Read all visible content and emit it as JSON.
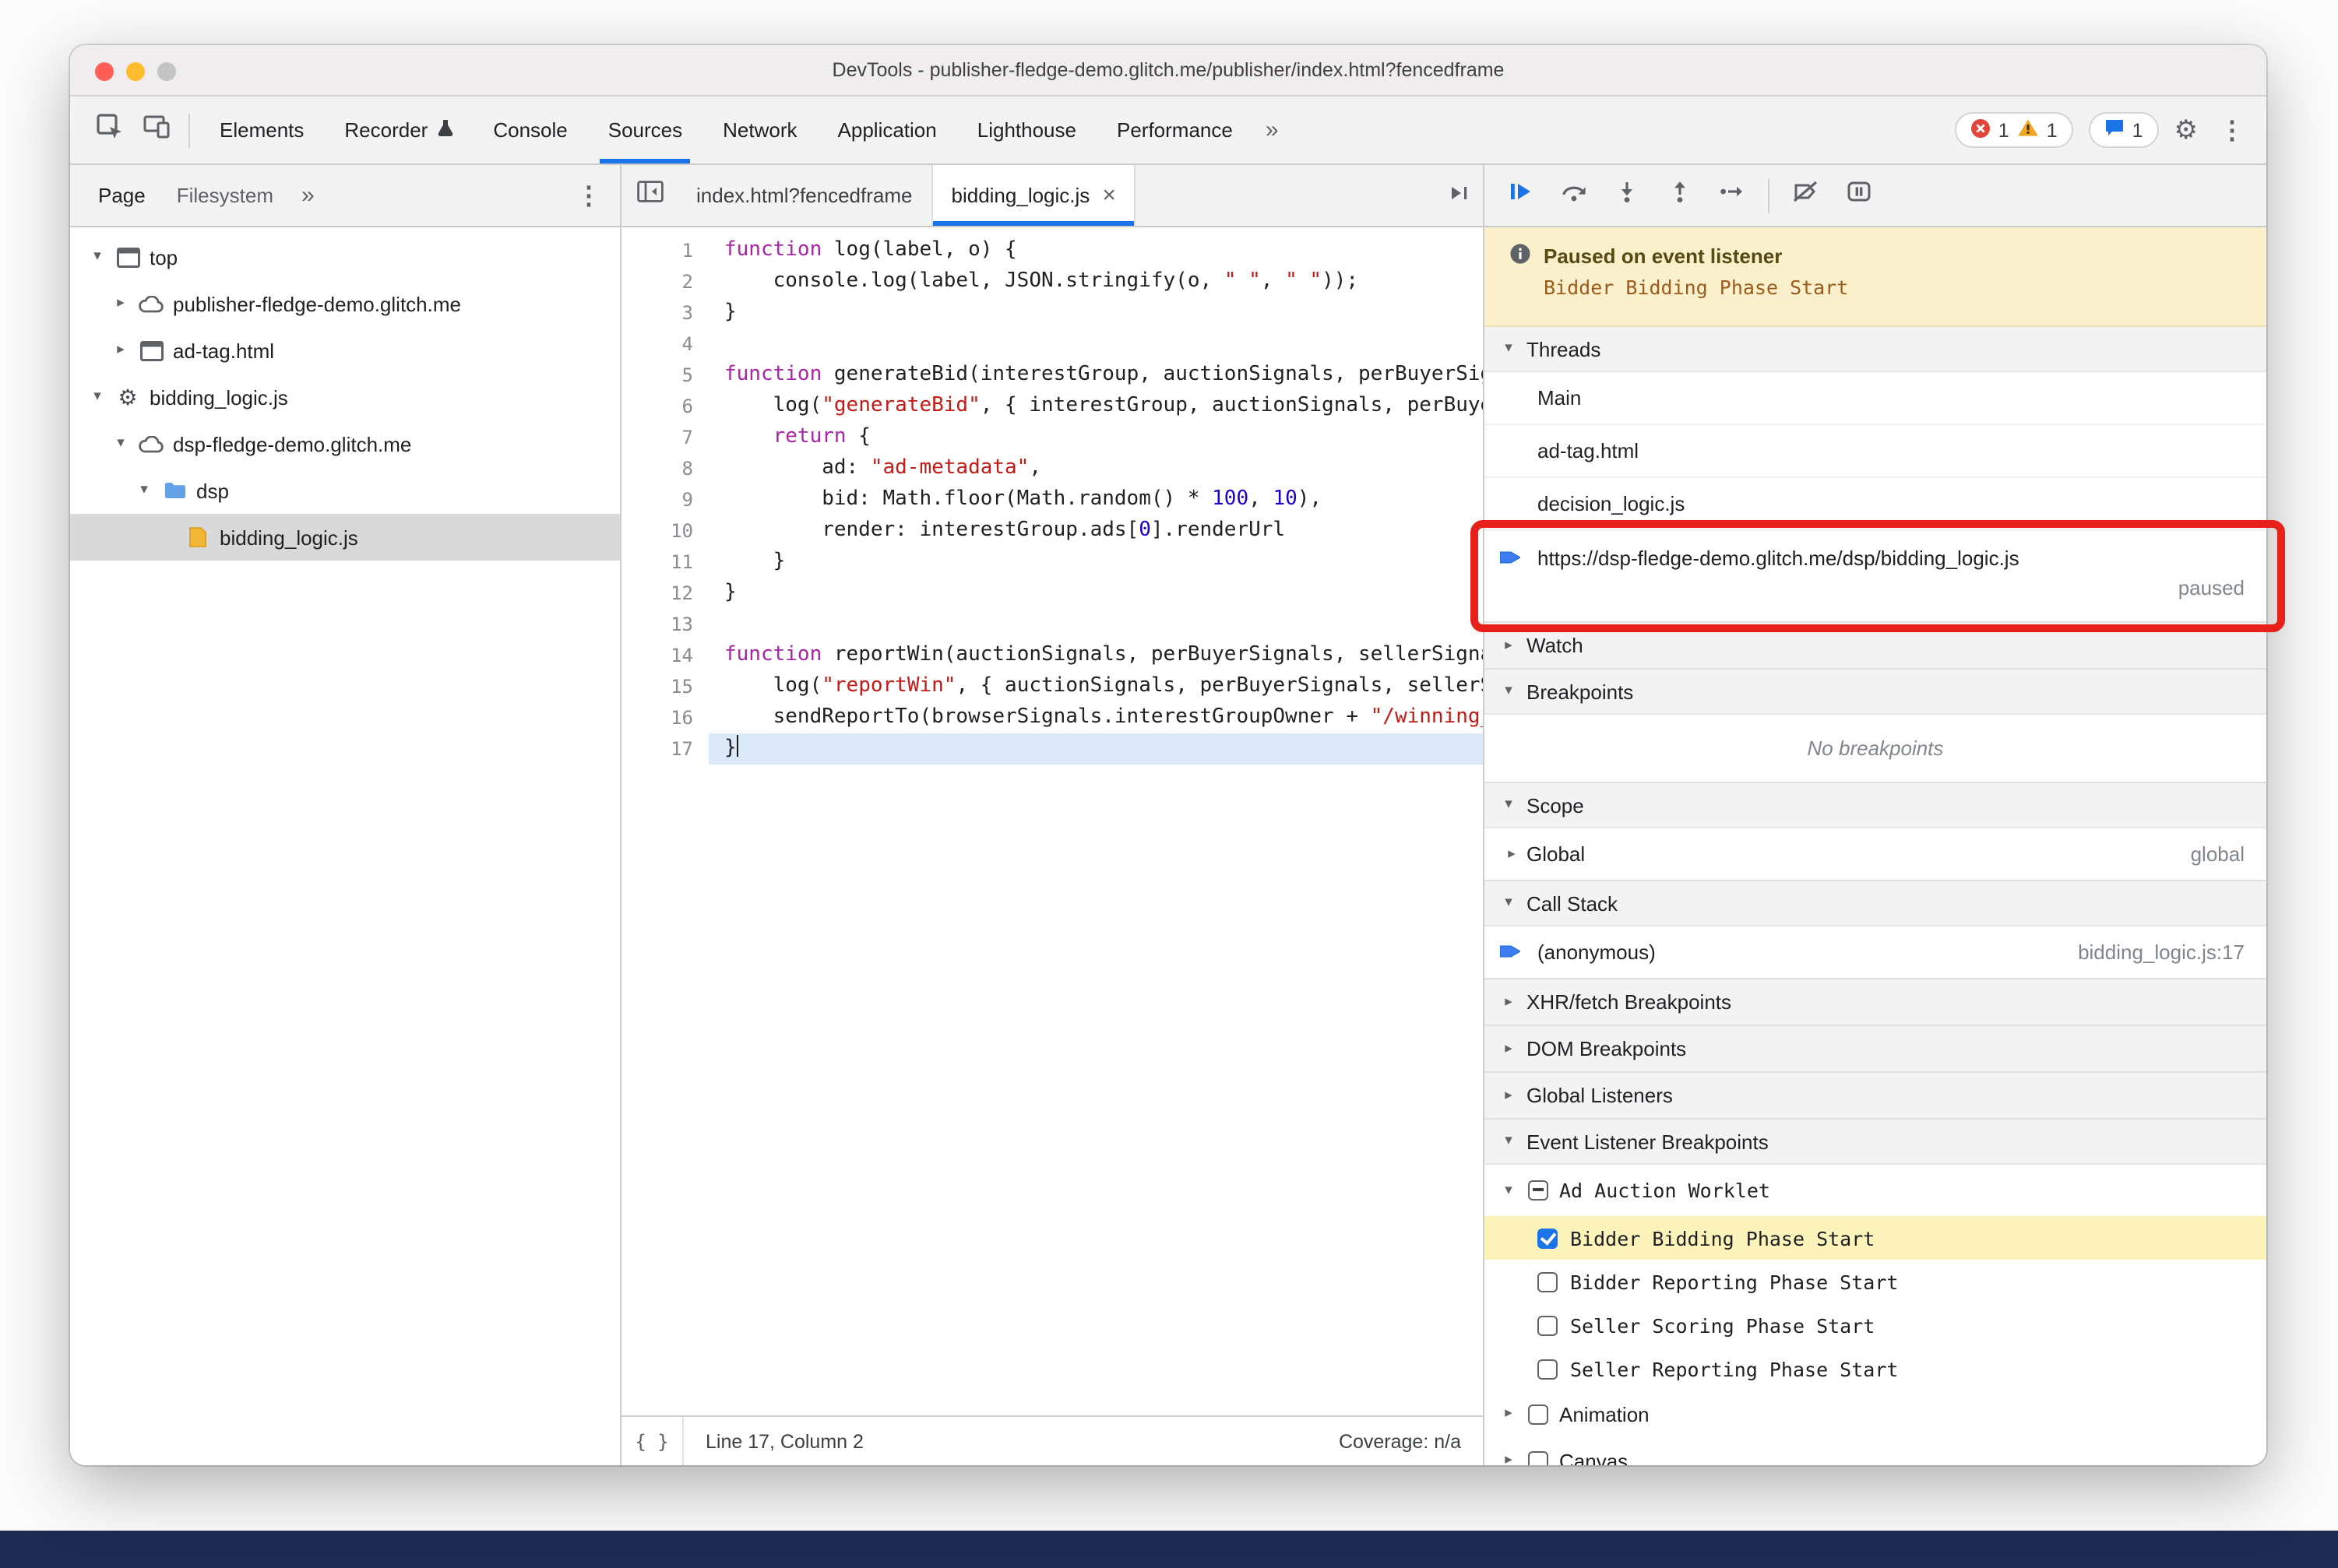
{
  "colors": {
    "accent_blue": "#1a73e8",
    "annotation_red": "#e8201a",
    "paused_banner_bg": "#fbf0cc",
    "selection_gray": "#d9d9d9",
    "breakpoint_highlight_yellow": "#fcf3bb",
    "paused_line_blue": "#dce9f9",
    "error_red": "#e5443b",
    "warning_yellow": "#f0a61f",
    "bottom_strip_navy": "#1e2a52"
  },
  "icons": {
    "gear": "⚙",
    "kebab": "⋮",
    "chevron_double": "»",
    "disclosure_open": "▾",
    "disclosure_closed": "▸",
    "close": "×",
    "pretty_print": "{ }"
  },
  "window": {
    "title": "DevTools - publisher-fledge-demo.glitch.me/publisher/index.html?fencedframe"
  },
  "toolbar": {
    "tabs": [
      {
        "label": "Elements"
      },
      {
        "label": "Recorder",
        "badge": "beaker-icon"
      },
      {
        "label": "Console"
      },
      {
        "label": "Sources",
        "active": true
      },
      {
        "label": "Network"
      },
      {
        "label": "Application"
      },
      {
        "label": "Lighthouse"
      },
      {
        "label": "Performance"
      }
    ],
    "error_count": "1",
    "warning_count": "1",
    "issue_count": "1"
  },
  "sidebar": {
    "tabs": [
      {
        "label": "Page",
        "active": true
      },
      {
        "label": "Filesystem"
      }
    ],
    "tree": [
      {
        "label": "top",
        "icon": "frame-icon",
        "disclosure": "open",
        "level": 0
      },
      {
        "label": "publisher-fledge-demo.glitch.me",
        "icon": "cloud-icon",
        "disclosure": "closed",
        "level": 1
      },
      {
        "label": "ad-tag.html",
        "icon": "frame-icon",
        "disclosure": "closed",
        "level": 1
      },
      {
        "label": "bidding_logic.js",
        "icon": "gear-icon",
        "disclosure": "open",
        "level": 0
      },
      {
        "label": "dsp-fledge-demo.glitch.me",
        "icon": "cloud-icon",
        "disclosure": "open",
        "level": 1
      },
      {
        "label": "dsp",
        "icon": "folder-icon",
        "disclosure": "open",
        "level": 2
      },
      {
        "label": "bidding_logic.js",
        "icon": "js-file-icon",
        "disclosure": "none",
        "level": 3,
        "selected": true
      }
    ]
  },
  "editor": {
    "tabs": [
      {
        "label": "index.html?fencedframe"
      },
      {
        "label": "bidding_logic.js",
        "active": true,
        "closable": true
      }
    ],
    "paused_line": 17,
    "code_lines": [
      {
        "n": 1,
        "tokens": [
          {
            "c": "k",
            "t": "function"
          },
          {
            "c": "d",
            "t": " log(label, o) {"
          }
        ]
      },
      {
        "n": 2,
        "tokens": [
          {
            "c": "d",
            "t": "    console.log(label, JSON.stringify(o, "
          },
          {
            "c": "s",
            "t": "\" \""
          },
          {
            "c": "d",
            "t": ", "
          },
          {
            "c": "s",
            "t": "\" \""
          },
          {
            "c": "d",
            "t": "));"
          }
        ]
      },
      {
        "n": 3,
        "tokens": [
          {
            "c": "d",
            "t": "}"
          }
        ]
      },
      {
        "n": 4,
        "tokens": []
      },
      {
        "n": 5,
        "tokens": [
          {
            "c": "k",
            "t": "function"
          },
          {
            "c": "d",
            "t": " generateBid(interestGroup, auctionSignals, perBuyerSignals, trustedBiddingSignals, browserSignals) {"
          }
        ]
      },
      {
        "n": 6,
        "tokens": [
          {
            "c": "d",
            "t": "    log("
          },
          {
            "c": "s",
            "t": "\"generateBid\""
          },
          {
            "c": "d",
            "t": ", { interestGroup, auctionSignals, perBuyerSignals, trustedBiddingSignals });"
          }
        ]
      },
      {
        "n": 7,
        "tokens": [
          {
            "c": "d",
            "t": "    "
          },
          {
            "c": "k",
            "t": "return"
          },
          {
            "c": "d",
            "t": " {"
          }
        ]
      },
      {
        "n": 8,
        "tokens": [
          {
            "c": "d",
            "t": "        ad: "
          },
          {
            "c": "s",
            "t": "\"ad-metadata\""
          },
          {
            "c": "d",
            "t": ","
          }
        ]
      },
      {
        "n": 9,
        "tokens": [
          {
            "c": "d",
            "t": "        bid: Math.floor(Math.random() * "
          },
          {
            "c": "n",
            "t": "100"
          },
          {
            "c": "d",
            "t": ", "
          },
          {
            "c": "n",
            "t": "10"
          },
          {
            "c": "d",
            "t": "),"
          }
        ]
      },
      {
        "n": 10,
        "tokens": [
          {
            "c": "d",
            "t": "        render: interestGroup.ads["
          },
          {
            "c": "n",
            "t": "0"
          },
          {
            "c": "d",
            "t": "].renderUrl"
          }
        ]
      },
      {
        "n": 11,
        "tokens": [
          {
            "c": "d",
            "t": "    }"
          }
        ]
      },
      {
        "n": 12,
        "tokens": [
          {
            "c": "d",
            "t": "}"
          }
        ]
      },
      {
        "n": 13,
        "tokens": []
      },
      {
        "n": 14,
        "tokens": [
          {
            "c": "k",
            "t": "function"
          },
          {
            "c": "d",
            "t": " reportWin(auctionSignals, perBuyerSignals, sellerSignals, browserSignals) {"
          }
        ]
      },
      {
        "n": 15,
        "tokens": [
          {
            "c": "d",
            "t": "    log("
          },
          {
            "c": "s",
            "t": "\"reportWin\""
          },
          {
            "c": "d",
            "t": ", { auctionSignals, perBuyerSignals, sellerSignals, browserSignals });"
          }
        ]
      },
      {
        "n": 16,
        "tokens": [
          {
            "c": "d",
            "t": "    sendReportTo(browserSignals.interestGroupOwner + "
          },
          {
            "c": "s",
            "t": "\"/winning_bid\""
          },
          {
            "c": "d",
            "t": ");"
          }
        ]
      },
      {
        "n": 17,
        "tokens": [
          {
            "c": "d",
            "t": "}"
          }
        ],
        "caret": true
      }
    ],
    "status": {
      "line_col": "Line 17, Column 2",
      "coverage": "Coverage: n/a"
    }
  },
  "debugger": {
    "banner": {
      "title": "Paused on event listener",
      "detail": "Bidder Bidding Phase Start"
    },
    "threads": {
      "title": "Threads",
      "rows": [
        {
          "label": "Main"
        },
        {
          "label": "ad-tag.html"
        },
        {
          "label": "decision_logic.js"
        },
        {
          "label": "https://dsp-fledge-demo.glitch.me/dsp/bidding_logic.js",
          "status": "paused",
          "active": true
        }
      ]
    },
    "watch": {
      "title": "Watch"
    },
    "breakpoints": {
      "title": "Breakpoints",
      "empty_text": "No breakpoints"
    },
    "scope": {
      "title": "Scope",
      "rows": [
        {
          "label": "Global",
          "annotation": "global"
        }
      ]
    },
    "call_stack": {
      "title": "Call Stack",
      "rows": [
        {
          "label": "(anonymous)",
          "location": "bidding_logic.js:17",
          "active": true
        }
      ]
    },
    "xhr_breakpoints": {
      "title": "XHR/fetch Breakpoints"
    },
    "dom_breakpoints": {
      "title": "DOM Breakpoints"
    },
    "global_listeners": {
      "title": "Global Listeners"
    },
    "event_listener_breakpoints": {
      "title": "Event Listener Breakpoints",
      "groups": [
        {
          "label": "Ad Auction Worklet",
          "checkbox": "indeterminate",
          "expanded": true,
          "mono": true,
          "children": [
            {
              "label": "Bidder Bidding Phase Start",
              "checked": true,
              "highlighted": true
            },
            {
              "label": "Bidder Reporting Phase Start",
              "checked": false
            },
            {
              "label": "Seller Scoring Phase Start",
              "checked": false
            },
            {
              "label": "Seller Reporting Phase Start",
              "checked": false
            }
          ]
        },
        {
          "label": "Animation",
          "checkbox": "unchecked",
          "expanded": false,
          "children": []
        },
        {
          "label": "Canvas",
          "checkbox": "unchecked",
          "expanded": false,
          "children": []
        }
      ]
    }
  }
}
